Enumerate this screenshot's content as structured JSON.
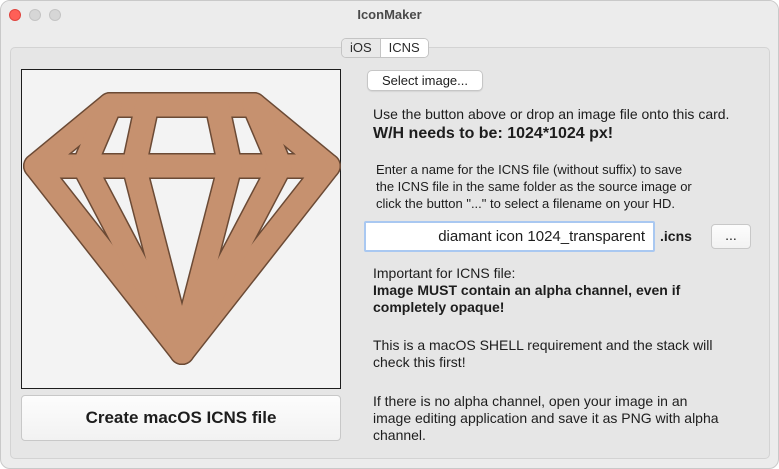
{
  "window": {
    "title": "IconMaker",
    "tabs": [
      {
        "label": "iOS",
        "active": false
      },
      {
        "label": "ICNS",
        "active": true
      }
    ]
  },
  "preview": {
    "icon": "diamond-icon",
    "fill_color": "#c6916f",
    "outline_color": "#6b4a35"
  },
  "actions": {
    "select_image_label": "Select image...",
    "create_label": "Create macOS ICNS file",
    "browse_label": "..."
  },
  "instructions": {
    "drop_hint": "Use the button above or drop an image file onto this card.",
    "size_requirement": "W/H needs to be: 1024*1024 px!",
    "name_line_1": "Enter a name for the ICNS file (without suffix) to save",
    "name_line_2": "the ICNS file in the same folder as the source image or",
    "name_line_3": "click the button \"...\" to select a filename on your HD."
  },
  "filename": {
    "value": "diamant icon 1024_transparent",
    "suffix": ".icns"
  },
  "notes": {
    "important_heading": "Important for ICNS file:",
    "alpha_line_1": "Image MUST contain an alpha channel, even if",
    "alpha_line_2": "completely opaque!",
    "shell_line_1": "This is a macOS SHELL requirement and the stack will",
    "shell_line_2": "check this first!",
    "fix_line_1": "If there is no alpha channel, open your image in an",
    "fix_line_2": "image editing application and save it as PNG with alpha",
    "fix_line_3": "channel."
  }
}
